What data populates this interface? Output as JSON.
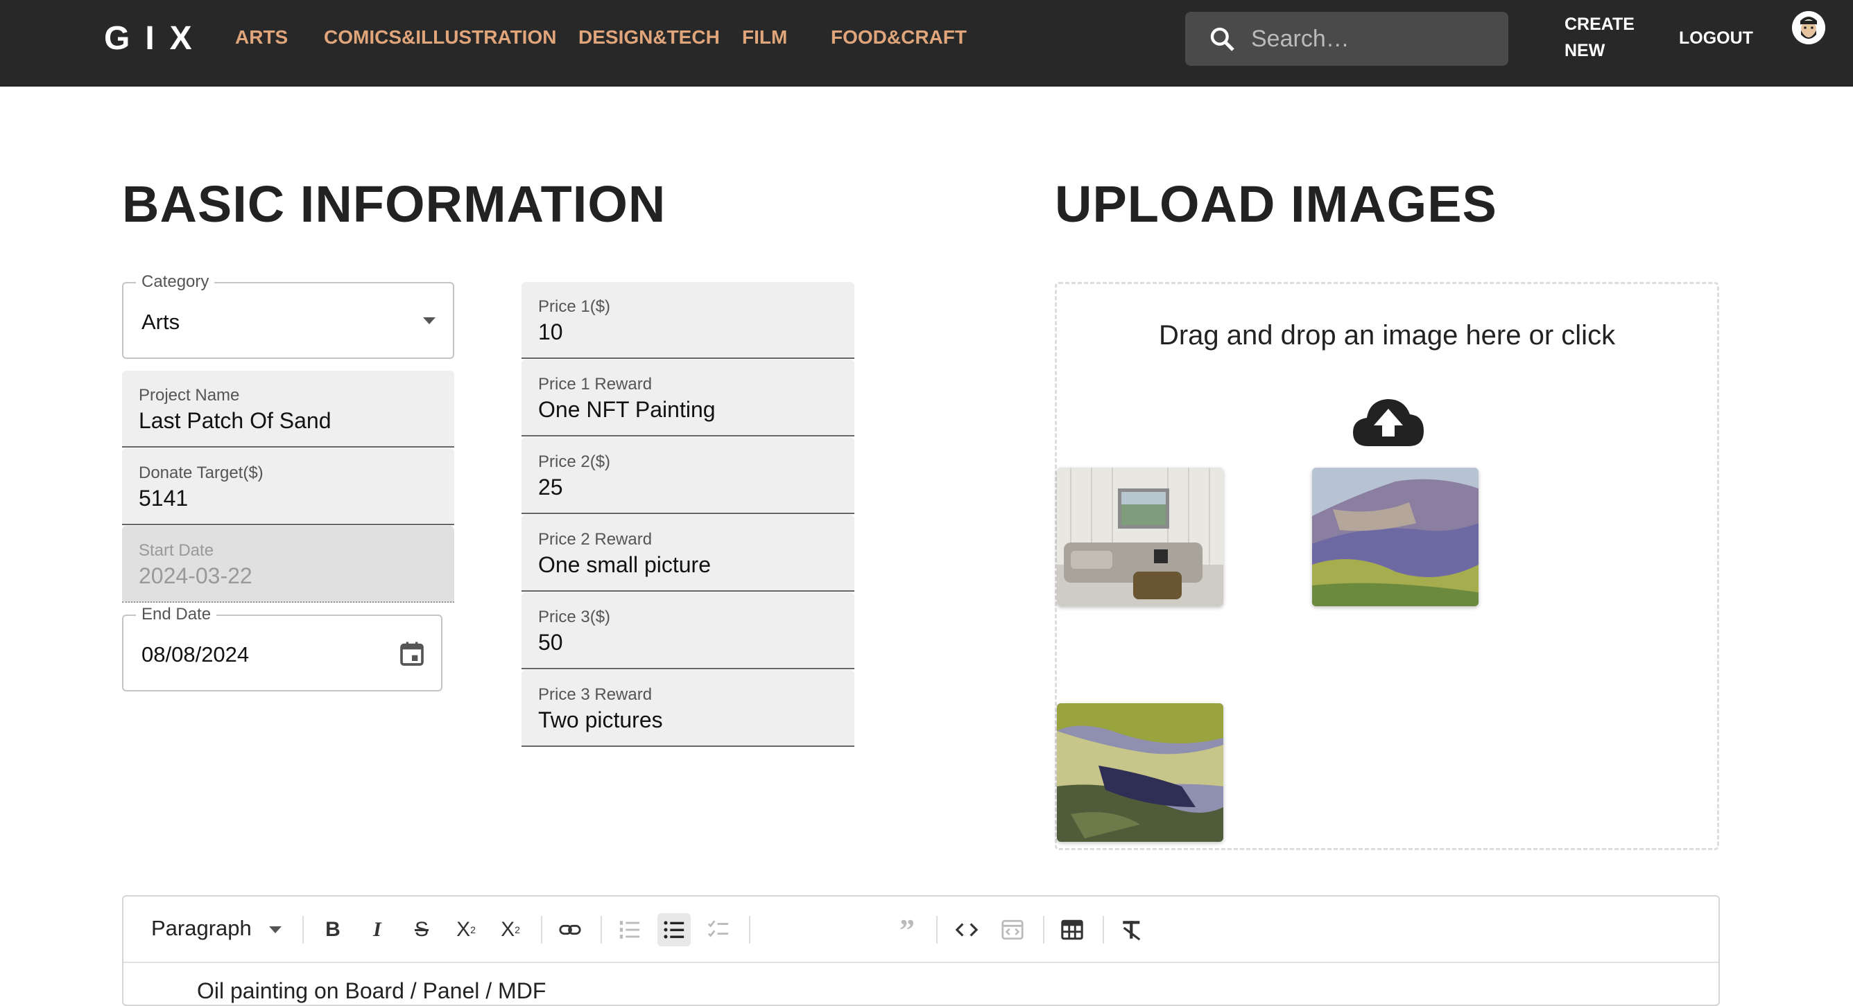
{
  "nav": {
    "logo": "GIX",
    "links": [
      "ARTS",
      "COMICS&ILLUSTRATION",
      "DESIGN&TECH",
      "FILM",
      "FOOD&CRAFT"
    ],
    "search_placeholder": "Search…",
    "create_line1": "CREATE",
    "create_line2": "NEW",
    "logout": "LOGOUT",
    "link_color": "#e0a57a",
    "bg_color": "#282828"
  },
  "basic": {
    "heading": "BASIC INFORMATION",
    "category": {
      "label": "Category",
      "value": "Arts"
    },
    "project_name": {
      "label": "Project Name",
      "value": "Last Patch Of Sand"
    },
    "donate_target": {
      "label": "Donate Target($)",
      "value": "5141"
    },
    "start_date": {
      "label": "Start Date",
      "value": "2024-03-22"
    },
    "end_date": {
      "label": "End Date",
      "value": "08/08/2024"
    },
    "price1": {
      "label": "Price 1($)",
      "value": "10"
    },
    "price1_reward": {
      "label": "Price 1 Reward",
      "value": "One NFT Painting"
    },
    "price2": {
      "label": "Price 2($)",
      "value": "25"
    },
    "price2_reward": {
      "label": "Price 2 Reward",
      "value": "One small picture"
    },
    "price3": {
      "label": "Price 3($)",
      "value": "50"
    },
    "price3_reward": {
      "label": "Price 3 Reward",
      "value": "Two pictures"
    }
  },
  "upload": {
    "heading": "UPLOAD IMAGES",
    "message": "Drag and drop an image here or click",
    "icon": "cloud-upload-icon"
  },
  "editor": {
    "paragraph_select": "Paragraph",
    "content_preview": "Oil painting on Board / Panel / MDF"
  }
}
